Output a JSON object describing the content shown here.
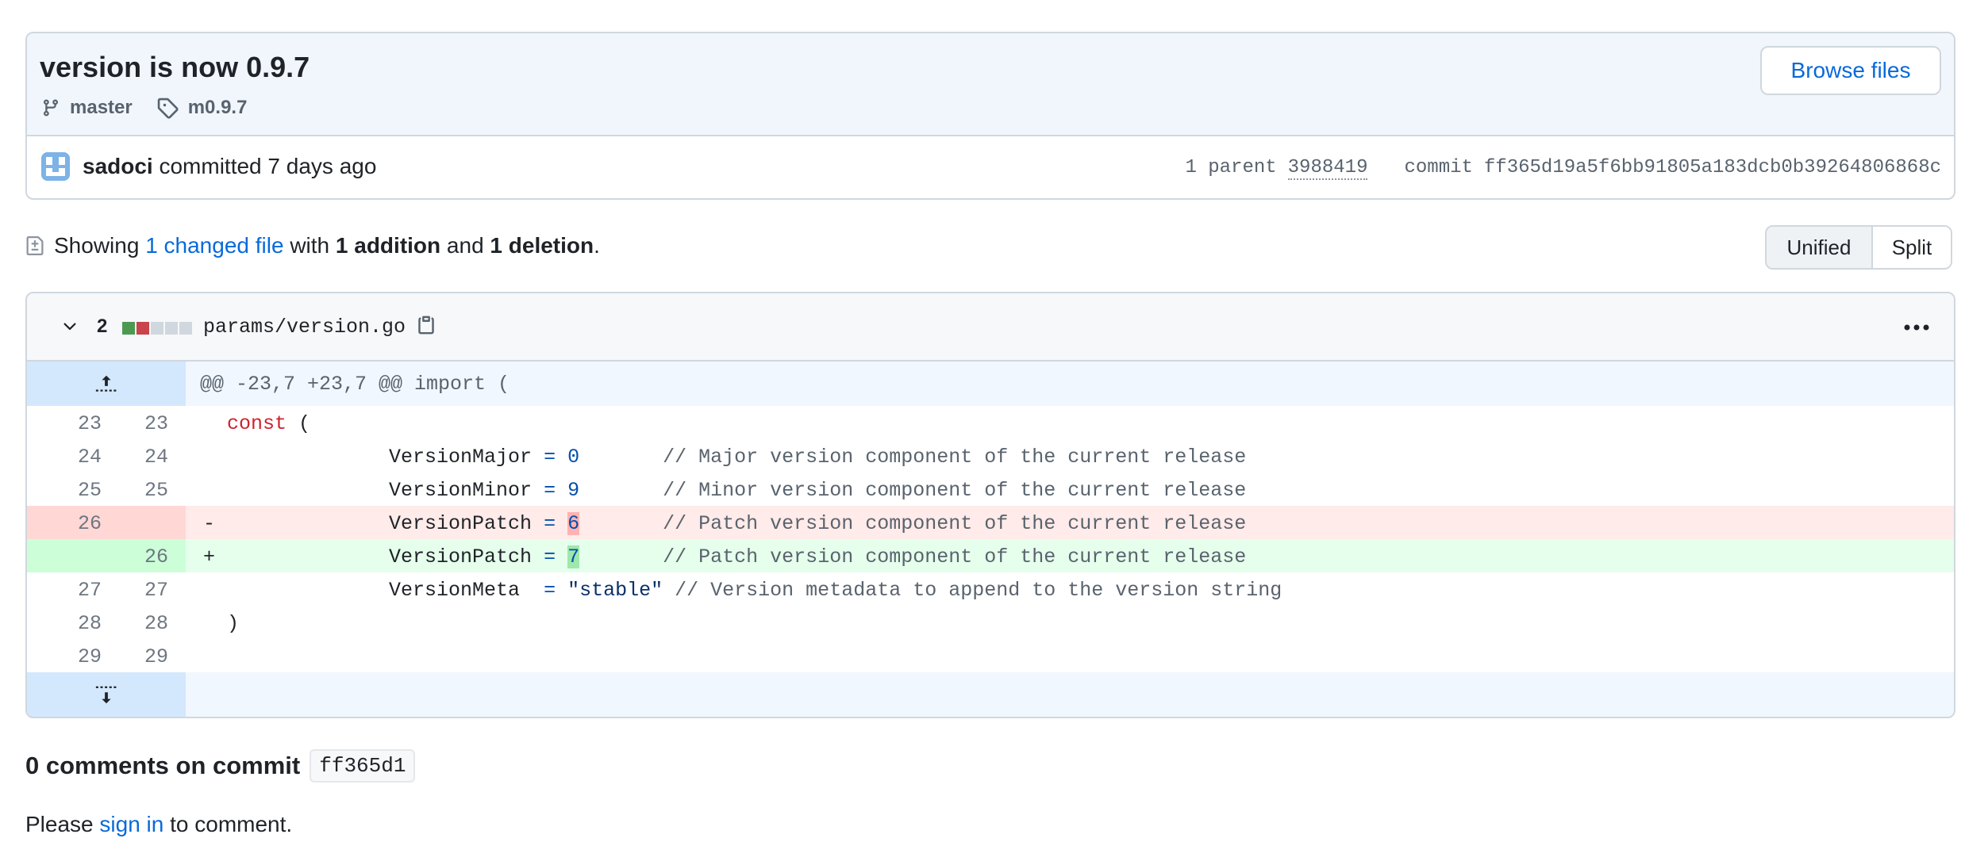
{
  "commit": {
    "title": "version is now 0.9.7",
    "branch": "master",
    "tag": "m0.9.7",
    "browse_label": "Browse files",
    "author": "sadoci",
    "action": "committed",
    "time": "7 days ago",
    "parent_label": "1 parent",
    "parent_sha": "3988419",
    "commit_label": "commit",
    "commit_sha": "ff365d19a5f6bb91805a183dcb0b39264806868c"
  },
  "summary": {
    "prefix": "Showing",
    "changed": "1 changed file",
    "with": "with",
    "additions": "1 addition",
    "and": "and",
    "deletions": "1 deletion",
    "period": "."
  },
  "view": {
    "unified": "Unified",
    "split": "Split",
    "selected": "Unified"
  },
  "file": {
    "change_count": "2",
    "path": "params/version.go",
    "hunk": "@@ -23,7 +23,7 @@ import (",
    "lines": [
      {
        "old": "23",
        "new": "23",
        "type": "context"
      },
      {
        "old": "24",
        "new": "24",
        "type": "context"
      },
      {
        "old": "25",
        "new": "25",
        "type": "context"
      },
      {
        "old": "26",
        "new": "",
        "type": "del"
      },
      {
        "old": "",
        "new": "26",
        "type": "add"
      },
      {
        "old": "27",
        "new": "27",
        "type": "context"
      },
      {
        "old": "28",
        "new": "28",
        "type": "context"
      },
      {
        "old": "29",
        "new": "29",
        "type": "context"
      }
    ],
    "code": {
      "l23_kw": "const",
      "l23_rest": " (",
      "l24_name": "\tVersionMajor ",
      "l24_eq": "=",
      "l24_val": "0",
      "l24_cm": "// Major version component of the current release",
      "l25_name": "\tVersionMinor ",
      "l25_eq": "=",
      "l25_val": "9",
      "l25_cm": "// Minor version component of the current release",
      "l26_name": "\tVersionPatch ",
      "l26_eq": "=",
      "l26_val_old": "6",
      "l26_val_new": "7",
      "l26_cm": "// Patch version component of the current release",
      "l27_name": "\tVersionMeta  ",
      "l27_eq": "=",
      "l27_val": "\"stable\"",
      "l27_cm": "// Version metadata to append to the version string",
      "l28": ")",
      "del_marker": "-",
      "add_marker": "+"
    }
  },
  "comments": {
    "title": "0 comments on commit",
    "sha": "ff365d1",
    "please": "Please",
    "signin": "sign in",
    "to_comment": "to comment."
  },
  "colors": {
    "accent": "#0969da",
    "add": "#e6ffec",
    "del": "#ffebe9",
    "diffstat_add": "#4c9a52",
    "diffstat_del": "#c9444b",
    "diffstat_neutral": "#d0d7de"
  }
}
